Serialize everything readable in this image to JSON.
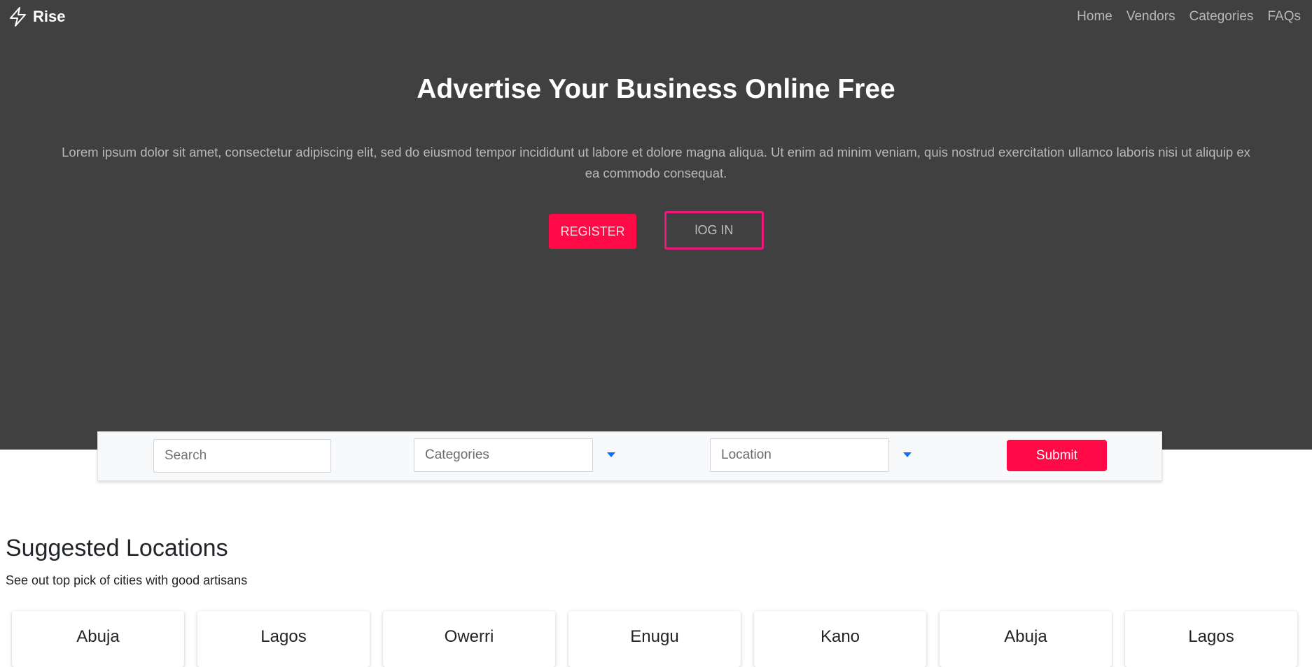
{
  "brand": {
    "name": "Rise",
    "icon": "lightning-bolt-icon"
  },
  "nav": {
    "items": [
      {
        "label": "Home"
      },
      {
        "label": "Vendors"
      },
      {
        "label": "Categories"
      },
      {
        "label": "FAQs"
      }
    ]
  },
  "hero": {
    "title": "Advertise Your Business Online Free",
    "text": "Lorem ipsum dolor sit amet, consectetur adipiscing elit, sed do eiusmod tempor incididunt ut labore et dolore magna aliqua. Ut enim ad minim veniam, quis nostrud exercitation ullamco laboris nisi ut aliquip ex ea commodo consequat.",
    "register_label": "REGISTER",
    "login_label": "lOG IN"
  },
  "search": {
    "search_placeholder": "Search",
    "categories_value": "Categories",
    "location_value": "Location",
    "submit_label": "Submit"
  },
  "locations": {
    "title": "Suggested Locations",
    "subtitle": "See out top pick of cities with good artisans",
    "cards": [
      {
        "name": "Abuja"
      },
      {
        "name": "Lagos"
      },
      {
        "name": "Owerri"
      },
      {
        "name": "Enugu"
      },
      {
        "name": "Kano"
      },
      {
        "name": "Abuja"
      },
      {
        "name": "Lagos"
      }
    ]
  },
  "colors": {
    "hero_bg": "#404040",
    "accent": "#ff0a47",
    "login_border": "#f0187c",
    "caret": "#0d6efd"
  }
}
